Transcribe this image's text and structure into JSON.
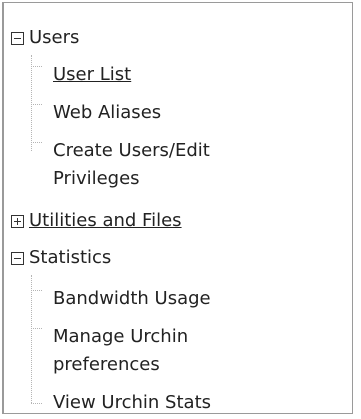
{
  "tree": {
    "users": {
      "label": "Users",
      "expanded": true,
      "children": [
        "User List",
        "Web Aliases",
        "Create Users/Edit",
        "Privileges"
      ]
    },
    "utilities": {
      "label": "Utilities and Files",
      "expanded": false
    },
    "statistics": {
      "label": "Statistics",
      "expanded": true,
      "children": [
        "Bandwidth Usage",
        "Manage Urchin",
        "preferences",
        "View Urchin Stats"
      ]
    }
  },
  "icons": {
    "collapse": "minus-box-icon",
    "expand": "plus-box-icon"
  },
  "colors": {
    "text": "#222222",
    "border": "#9a9a9a",
    "connector": "#b5b5b5"
  }
}
